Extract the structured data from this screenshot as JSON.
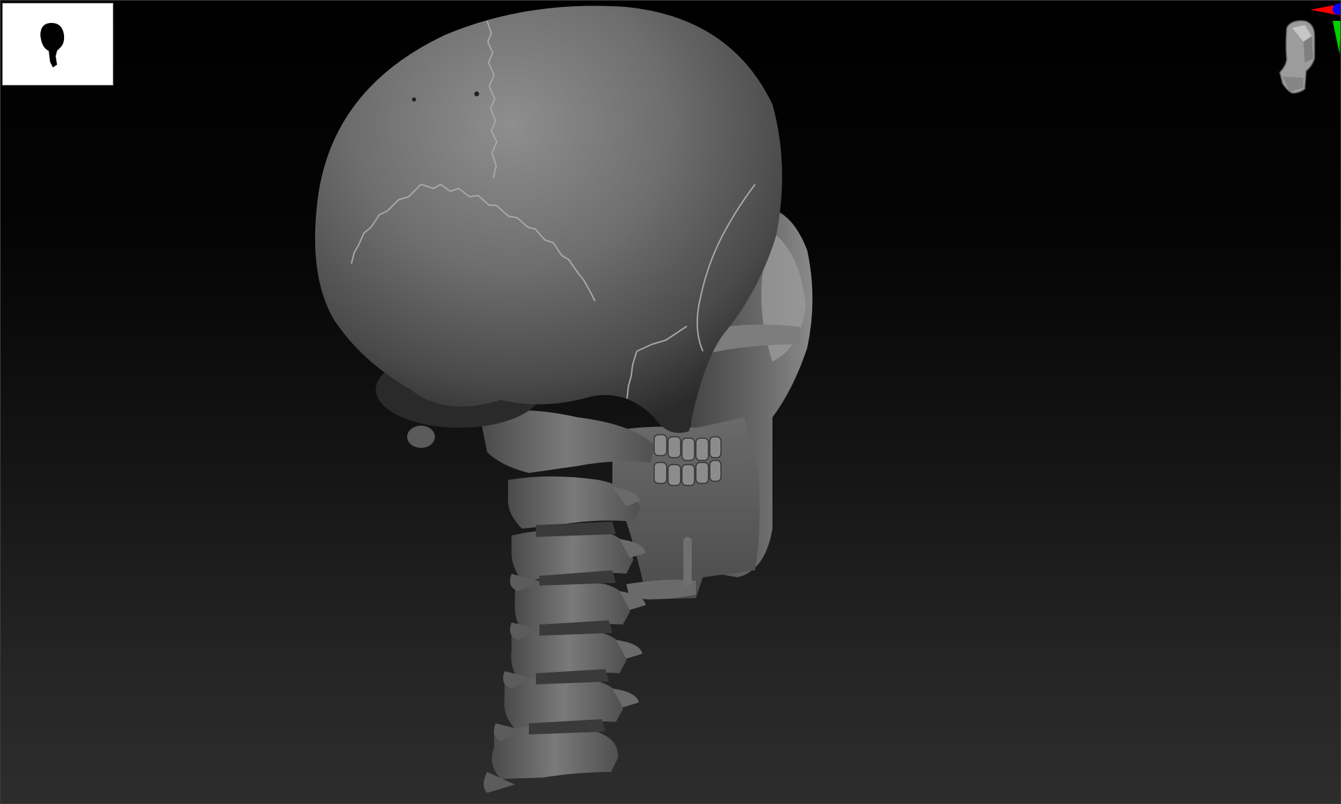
{
  "app": {
    "name": "",
    "view": "3d-viewport"
  },
  "viewport": {
    "background_top": "#000000",
    "background_bottom": "#2d2d2d",
    "model_color": "#6f6f6f"
  },
  "navigator": {
    "icon": "skull-silhouette-icon",
    "background": "#ffffff"
  },
  "gizmo": {
    "icon": "orientation-head-icon",
    "x_axis_color": "#ff0000",
    "y_axis_color": "#00d000",
    "z_axis_color": "#0000ff"
  }
}
